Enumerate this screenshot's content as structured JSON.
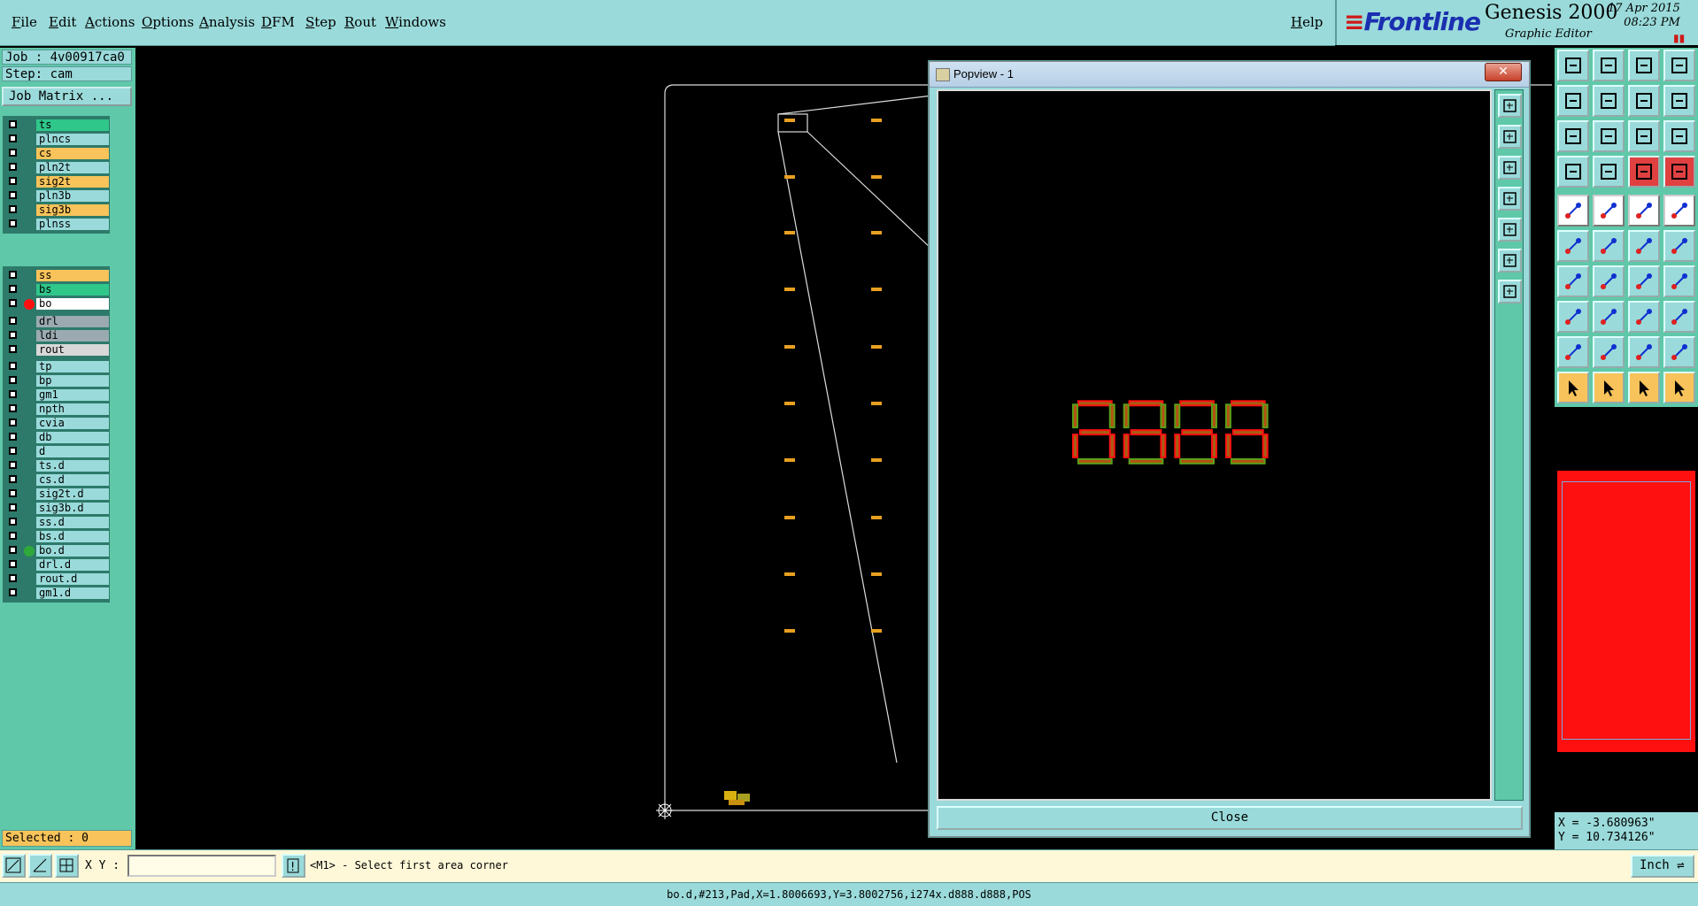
{
  "menu": [
    "File",
    "Edit",
    "Actions",
    "Options",
    "Analysis",
    "DFM",
    "Step",
    "Rout",
    "Windows"
  ],
  "help": "Help",
  "brand": {
    "logo": "Frontline",
    "product": "Genesis 2000",
    "subtitle": "Graphic Editor",
    "date": "17 Apr 2015",
    "time": "08:23 PM"
  },
  "job": {
    "job_line": "Job : 4v00917ca0",
    "step_line": "Step: cam",
    "matrix_button": "Job Matrix ..."
  },
  "layer_groups": [
    [
      {
        "name": "ts",
        "color": "#2fc78a",
        "dot": ""
      },
      {
        "name": "plncs",
        "color": "#9adada",
        "dot": ""
      },
      {
        "name": "cs",
        "color": "#f7c35a",
        "dot": ""
      },
      {
        "name": "pln2t",
        "color": "#9adada",
        "dot": ""
      },
      {
        "name": "sig2t",
        "color": "#f7c35a",
        "dot": ""
      },
      {
        "name": "pln3b",
        "color": "#9adada",
        "dot": ""
      },
      {
        "name": "sig3b",
        "color": "#f7c35a",
        "dot": ""
      },
      {
        "name": "plnss",
        "color": "#9adada",
        "dot": ""
      }
    ],
    [
      {
        "name": "ss",
        "color": "#f7c35a",
        "dot": ""
      },
      {
        "name": "bs",
        "color": "#2fc78a",
        "dot": ""
      },
      {
        "name": "bo",
        "color": "#ffffff",
        "dot": "#ff1010"
      }
    ],
    [
      {
        "name": "drl",
        "color": "#9aaab0",
        "dot": ""
      },
      {
        "name": "ldi",
        "color": "#9aaab0",
        "dot": ""
      },
      {
        "name": "rout",
        "color": "#d8d8d8",
        "dot": ""
      }
    ],
    [
      {
        "name": "tp",
        "color": "#9adada",
        "dot": ""
      },
      {
        "name": "bp",
        "color": "#9adada",
        "dot": ""
      },
      {
        "name": "gm1",
        "color": "#9adada",
        "dot": ""
      },
      {
        "name": "npth",
        "color": "#9adada",
        "dot": ""
      },
      {
        "name": "cvia",
        "color": "#9adada",
        "dot": ""
      },
      {
        "name": "db",
        "color": "#9adada",
        "dot": ""
      },
      {
        "name": "d",
        "color": "#9adada",
        "dot": ""
      },
      {
        "name": "ts.d",
        "color": "#9adada",
        "dot": ""
      },
      {
        "name": "cs.d",
        "color": "#9adada",
        "dot": ""
      },
      {
        "name": "sig2t.d",
        "color": "#9adada",
        "dot": ""
      },
      {
        "name": "sig3b.d",
        "color": "#9adada",
        "dot": ""
      },
      {
        "name": "ss.d",
        "color": "#9adada",
        "dot": ""
      },
      {
        "name": "bs.d",
        "color": "#9adada",
        "dot": ""
      },
      {
        "name": "bo.d",
        "color": "#9adada",
        "dot": "#2faa3a"
      },
      {
        "name": "drl.d",
        "color": "#9adada",
        "dot": ""
      },
      {
        "name": "rout.d",
        "color": "#9adada",
        "dot": ""
      },
      {
        "name": "gm1.d",
        "color": "#9adada",
        "dot": ""
      }
    ]
  ],
  "selected": "Selected : 0",
  "popview": {
    "title": "Popview - 1",
    "close_label": "Close",
    "close_x": "✕"
  },
  "coords": {
    "x": "X = -3.680963\"",
    "y": "Y = 10.734126\""
  },
  "bottom": {
    "xy_label": "X Y :",
    "input_value": "",
    "prompt": "<M1> - Select first area corner",
    "unit": "Inch"
  },
  "status": "bo.d,#213,Pad,X=1.8006693,Y=3.8002756,i274x.d888.d888,POS",
  "colors": {
    "panel": "#9adada",
    "panel_dark": "#5fc8a8",
    "feature_orange": "#e8a020",
    "pad_green": "#5aa018",
    "pad_red": "#ff1010"
  }
}
